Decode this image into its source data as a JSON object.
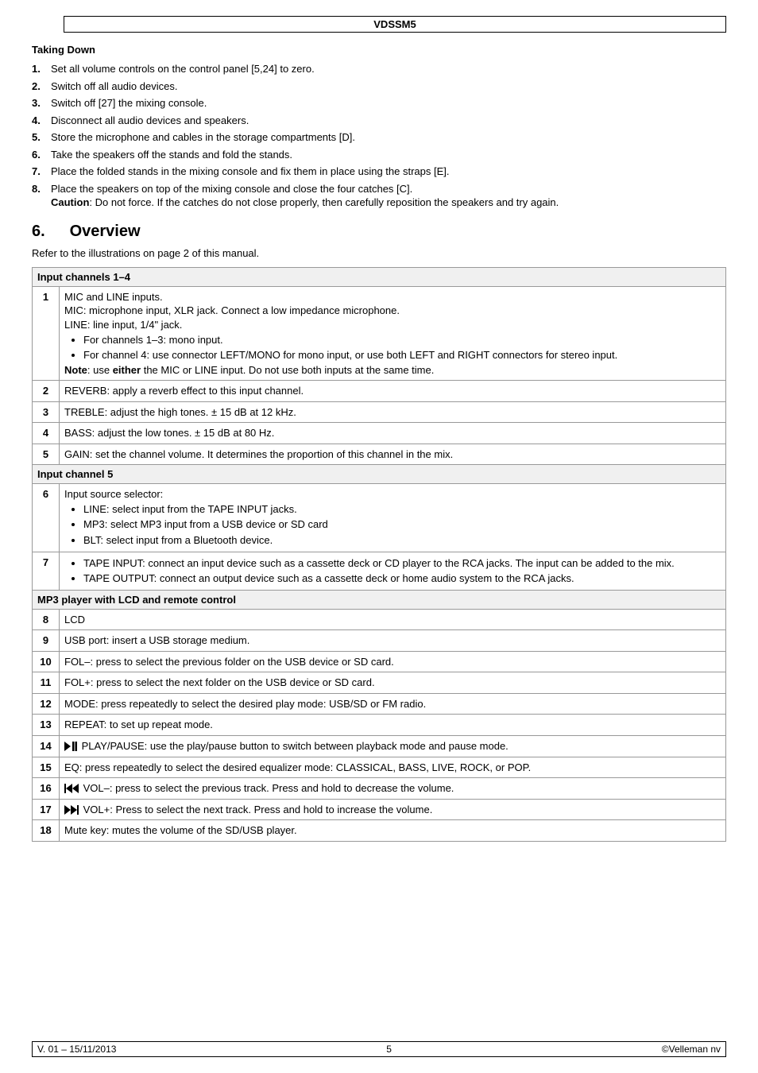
{
  "header": {
    "title": "VDSSM5"
  },
  "taking_down": {
    "title": "Taking Down",
    "items": [
      "Set all volume controls on the control panel [5,24] to zero.",
      "Switch off all audio devices.",
      "Switch off [27] the mixing console.",
      "Disconnect all audio devices and speakers.",
      "Store the microphone and cables in the storage compartments [D].",
      "Take the speakers off the stands and fold the stands.",
      "Place the folded stands in the mixing console and fix them in place using the straps [E].",
      "Place the speakers on top of the mixing console and close the four catches [C].\n<b>Caution</b>: Do not force. If the catches do not close properly, then carefully reposition the speakers and try again."
    ]
  },
  "overview": {
    "num": "6.",
    "title": "Overview",
    "refer": "Refer to the illustrations on page 2 of this manual."
  },
  "table": {
    "sections": [
      {
        "header": "Input channels 1–4",
        "rows": [
          {
            "idx": "1",
            "html": "MIC and LINE inputs.<br>MIC: microphone input, XLR jack. Connect a low impedance microphone.<br>LINE: line input, 1/4\" jack.<ul class='bul'><li>For channels 1–3: mono input.</li><li>For channel 4: use connector LEFT/MONO for mono input, or use both LEFT and RIGHT connectors for stereo input.</li></ul><b>Note</b>: use <b>either</b> the MIC or LINE input. Do not use both inputs at the same time."
          },
          {
            "idx": "2",
            "html": "REVERB: apply a reverb effect to this input channel."
          },
          {
            "idx": "3",
            "html": "TREBLE: adjust the high tones. ± 15 dB at 12 kHz."
          },
          {
            "idx": "4",
            "html": "BASS: adjust the low tones. ± 15 dB at 80 Hz."
          },
          {
            "idx": "5",
            "html": "GAIN: set the channel volume. It determines the proportion of this channel in the mix."
          }
        ]
      },
      {
        "header": "Input channel 5",
        "rows": [
          {
            "idx": "6",
            "html": "Input source selector:<ul class='bul'><li>LINE: select input from the TAPE INPUT jacks.</li><li>MP3: select MP3 input from a USB device or SD card</li><li>BLT: select input from a Bluetooth device.</li></ul>"
          },
          {
            "idx": "7",
            "html": "<ul class='bul'><li>TAPE INPUT: connect an input device such as a cassette deck or CD player to the RCA jacks. The input can be added to the mix.</li><li>TAPE OUTPUT: connect an output device such as a cassette deck or home audio system to the RCA jacks.</li></ul>"
          }
        ]
      },
      {
        "header": "MP3 player with LCD and remote control",
        "rows": [
          {
            "idx": "8",
            "html": "LCD"
          },
          {
            "idx": "9",
            "html": "USB port: insert a USB storage medium."
          },
          {
            "idx": "10",
            "html": "FOL–: press to select the previous folder on the USB device or SD card."
          },
          {
            "idx": "11",
            "html": "FOL+: press to select the next folder on the USB device or SD card."
          },
          {
            "idx": "12",
            "html": "MODE: press repeatedly to select the desired play mode: USB/SD or FM radio."
          },
          {
            "idx": "13",
            "html": "REPEAT: to set up repeat mode."
          },
          {
            "idx": "14",
            "icon": "play-pause",
            "html": " PLAY/PAUSE: use the play/pause button to switch between playback mode and pause mode."
          },
          {
            "idx": "15",
            "html": "EQ: press repeatedly to select the desired equalizer mode: CLASSICAL, BASS, LIVE, ROCK, or POP."
          },
          {
            "idx": "16",
            "icon": "prev",
            "html": " VOL–: press to select the previous track. Press and hold to decrease the volume."
          },
          {
            "idx": "17",
            "icon": "next",
            "html": " VOL+: Press to select the next track. Press and hold to increase the volume."
          },
          {
            "idx": "18",
            "html": "Mute key: mutes the volume of the SD/USB player."
          }
        ]
      }
    ]
  },
  "footer": {
    "left": "V. 01 – 15/11/2013",
    "center": "5",
    "right": "©Velleman nv"
  },
  "icons": {
    "play-pause": "<svg class='icon-svg' width='16' height='12' viewBox='0 0 16 12'><polygon points='0,0 8,6 0,12' fill='#000'/><rect x='10' y='0' width='2.5' height='12' fill='#000'/><rect x='13.5' y='0' width='2.5' height='12' fill='#000'/></svg>",
    "prev": "<svg class='icon-svg' width='18' height='12' viewBox='0 0 18 12'><rect x='0' y='0' width='2' height='12' fill='#000'/><polygon points='10,0 2,6 10,12' fill='#000'/><polygon points='18,0 10,6 18,12' fill='#000'/></svg>",
    "next": "<svg class='icon-svg' width='18' height='12' viewBox='0 0 18 12'><polygon points='0,0 8,6 0,12' fill='#000'/><polygon points='8,0 16,6 8,12' fill='#000'/><rect x='16' y='0' width='2' height='12' fill='#000'/></svg>"
  }
}
